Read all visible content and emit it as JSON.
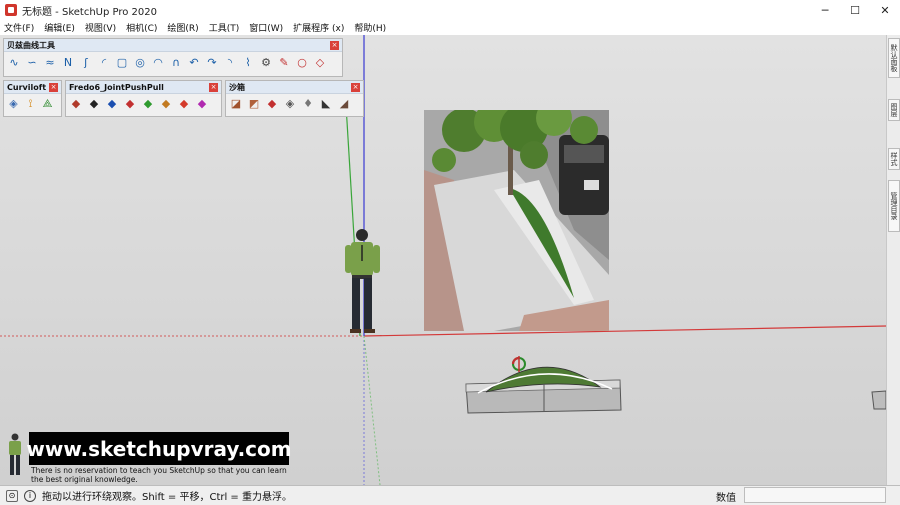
{
  "window": {
    "title": "无标题 - SketchUp Pro 2020",
    "minimize": "─",
    "maximize": "☐",
    "close": "✕"
  },
  "menu": [
    "文件(F)",
    "编辑(E)",
    "视图(V)",
    "相机(C)",
    "绘图(R)",
    "工具(T)",
    "窗口(W)",
    "扩展程序 (x)",
    "帮助(H)"
  ],
  "toolbars": {
    "bezier": {
      "title": "贝兹曲线工具",
      "close": "×"
    },
    "curviloft": {
      "title": "Curviloft",
      "close": "×"
    },
    "fredo": {
      "title": "Fredo6_JointPushPull",
      "close": "×"
    },
    "sandbox": {
      "title": "沙箱",
      "close": "×"
    }
  },
  "side_tabs": [
    "默认面板",
    "图层",
    "样式",
    "管理目录"
  ],
  "watermark": {
    "url": "www.sketchupvray.com",
    "note_line1": "There is no reservation to teach you SketchUp so that you can learn",
    "note_line2": "the best original knowledge."
  },
  "status": {
    "message": "拖动以进行环绕观察。Shift = 平移，Ctrl = 重力悬浮。",
    "measure_label": "数值",
    "measure_value": ""
  },
  "colors": {
    "axis_red": "#d33a3a",
    "axis_green": "#3aa63a",
    "axis_blue": "#3a3ad3",
    "grass": "#3f7a2c"
  }
}
